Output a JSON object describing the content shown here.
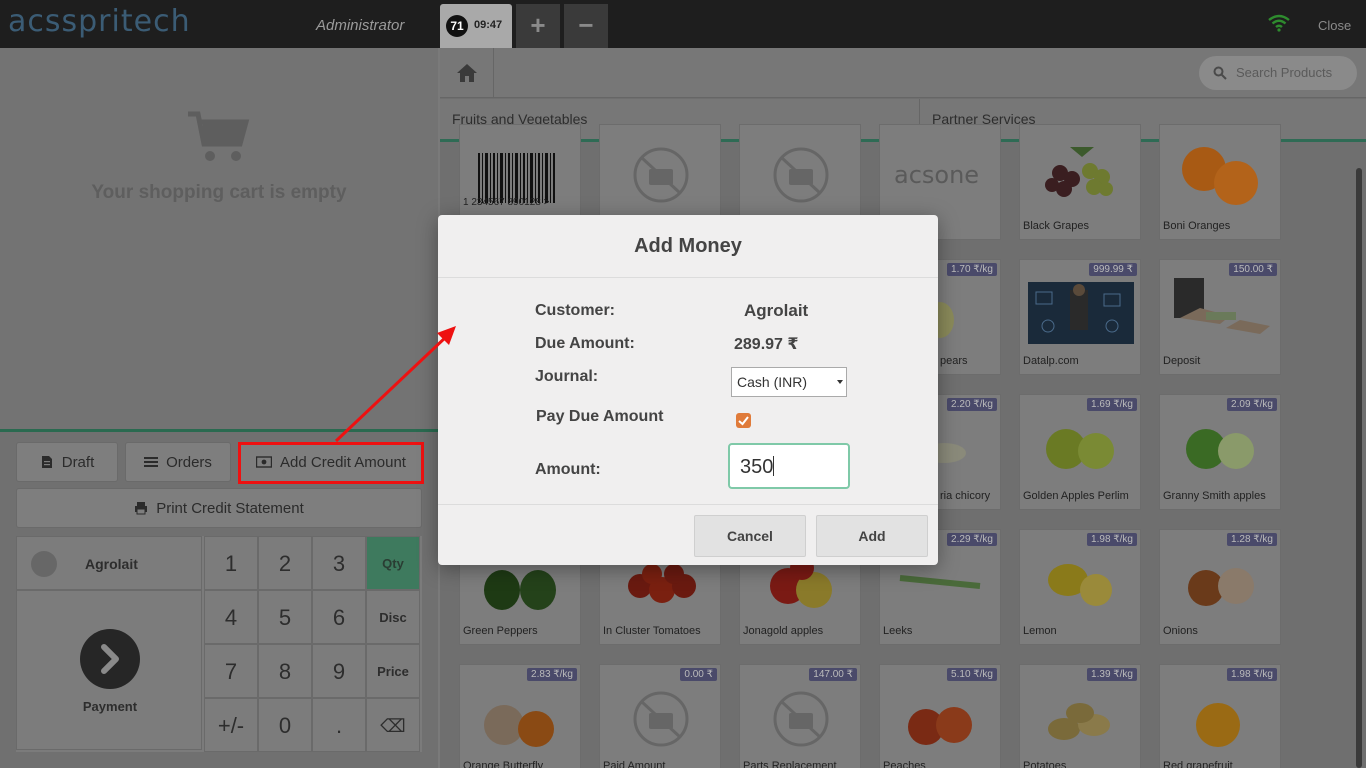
{
  "header": {
    "logo": "acsspritech",
    "user": "Administrator",
    "order_number": "71",
    "order_time": "09:47",
    "add_order": "+",
    "remove_order": "−",
    "close": "Close"
  },
  "cart": {
    "empty_text": "Your shopping cart is empty"
  },
  "actions": {
    "draft": "Draft",
    "orders": "Orders",
    "add_credit": "Add Credit Amount",
    "print_statement": "Print Credit Statement"
  },
  "numpad": {
    "customer": "Agrolait",
    "payment": "Payment",
    "keys": [
      "1",
      "2",
      "3",
      "4",
      "5",
      "6",
      "7",
      "8",
      "9",
      "+/-",
      "0",
      "."
    ],
    "modes": [
      "Qty",
      "Disc",
      "Price"
    ],
    "backspace": "⌫"
  },
  "products_panel": {
    "search_placeholder": "Search Products",
    "categories": [
      "Fruits and Vegetables",
      "Partner Services"
    ],
    "barcode_text": "1 234567 890128 >",
    "brand_tile": "acsone",
    "products": [
      {
        "name": "Black Grapes",
        "price": ""
      },
      {
        "name": "Boni Oranges",
        "price": ""
      },
      {
        "name": "pears",
        "price": "1.70 ₹/kg"
      },
      {
        "name": "Datalp.com",
        "price": "999.99 ₹"
      },
      {
        "name": "Deposit",
        "price": "150.00 ₹"
      },
      {
        "name": "ria chicory",
        "price": "2.20 ₹/kg"
      },
      {
        "name": "Golden Apples Perlim",
        "price": "1.69 ₹/kg"
      },
      {
        "name": "Granny Smith apples",
        "price": "2.09 ₹/kg"
      },
      {
        "name": "Green Peppers",
        "price": ""
      },
      {
        "name": "In Cluster Tomatoes",
        "price": ""
      },
      {
        "name": "Jonagold apples",
        "price": ""
      },
      {
        "name": "Leeks",
        "price": "2.29 ₹/kg"
      },
      {
        "name": "Lemon",
        "price": "1.98 ₹/kg"
      },
      {
        "name": "Onions",
        "price": "1.28 ₹/kg"
      },
      {
        "name": "Orange Butterfly",
        "price": "2.83 ₹/kg"
      },
      {
        "name": "Paid Amount",
        "price": "0.00 ₹"
      },
      {
        "name": "Parts Replacement",
        "price": "147.00 ₹"
      },
      {
        "name": "Peaches",
        "price": "5.10 ₹/kg"
      },
      {
        "name": "Potatoes",
        "price": "1.39 ₹/kg"
      },
      {
        "name": "Red grapefruit",
        "price": "1.98 ₹/kg"
      }
    ]
  },
  "dialog": {
    "title": "Add Money",
    "customer_label": "Customer:",
    "customer_value": "Agrolait",
    "due_label": "Due Amount:",
    "due_value": "289.97 ₹",
    "journal_label": "Journal:",
    "journal_value": "Cash (INR)",
    "pay_due_label": "Pay Due Amount",
    "pay_due_checked": true,
    "amount_label": "Amount:",
    "amount_value": "350",
    "cancel": "Cancel",
    "add": "Add"
  },
  "colors": {
    "accent_green": "#7fc9a8",
    "annotation_red": "#ee1111",
    "checkbox_orange": "#e07b3a"
  }
}
